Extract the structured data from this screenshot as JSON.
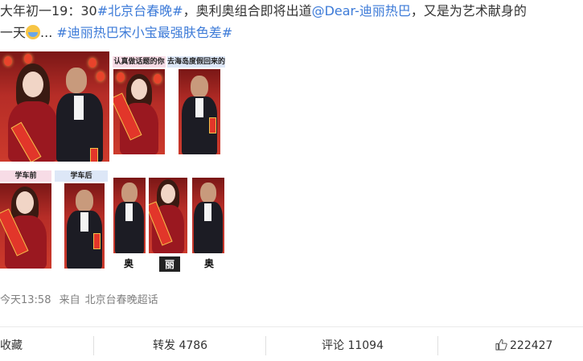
{
  "post": {
    "line1_prefix": "大年初一19：30",
    "line1_tag1": "#北京台春晚#",
    "line1_mid": "，奥利奥组合即将出道",
    "line1_mention": "@Dear-迪丽热巴",
    "line1_suffix": "，又是为艺术献身的",
    "line2_prefix": "一天",
    "line2_ellipsis": "...",
    "line2_tag2": "#迪丽热巴宋小宝最强肤色差#"
  },
  "images": {
    "caption_2": "认真做话题的你",
    "caption_3": "去海岛度假回来的",
    "caption_4": "学车前",
    "caption_5": "学车后",
    "char_1": "奥",
    "char_2": "丽",
    "char_3": "奥"
  },
  "meta": {
    "time": "今天13:58",
    "from_label": "来自",
    "source": "北京台春晚超话"
  },
  "actions": {
    "favorite": "收藏",
    "repost": "转发 4786",
    "comment": "评论 11094",
    "like": "222427"
  },
  "colors": {
    "topic": "#eb7350",
    "mention": "#eb7350"
  },
  "icons": {
    "emoji": "hug-emoji",
    "like": "thumbs-up-icon"
  }
}
